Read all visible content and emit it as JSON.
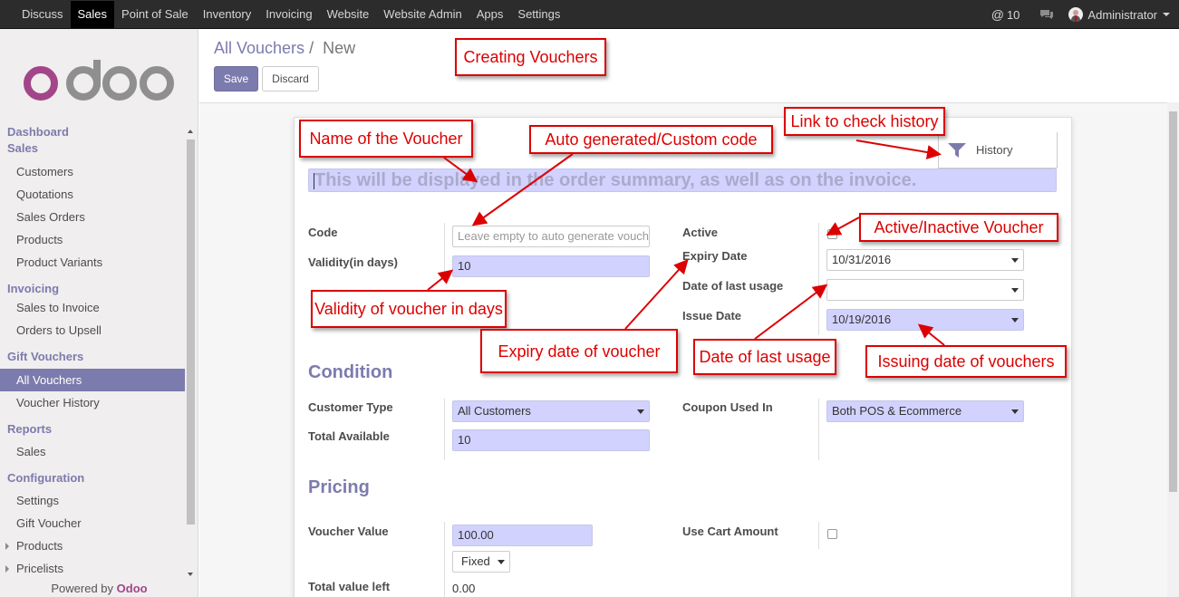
{
  "topbar": {
    "menu": [
      "Discuss",
      "Sales",
      "Point of Sale",
      "Inventory",
      "Invoicing",
      "Website",
      "Website Admin",
      "Apps",
      "Settings"
    ],
    "active_menu": "Sales",
    "messages_count": "10",
    "user": "Administrator"
  },
  "sidebar": {
    "sections": [
      {
        "header": "Dashboard",
        "items": []
      },
      {
        "header": "Sales",
        "items": [
          "Customers",
          "Quotations",
          "Sales Orders",
          "Products",
          "Product Variants"
        ]
      },
      {
        "header": "Invoicing",
        "items": [
          "Sales to Invoice",
          "Orders to Upsell"
        ]
      },
      {
        "header": "Gift Vouchers",
        "items": [
          "All Vouchers",
          "Voucher History"
        ]
      },
      {
        "header": "Reports",
        "items": [
          "Sales"
        ]
      },
      {
        "header": "Configuration",
        "items": [
          "Settings",
          "Gift Voucher",
          "Products",
          "Pricelists"
        ]
      }
    ],
    "active_item": "All Vouchers",
    "powered_prefix": "Powered by",
    "powered_brand": "Odoo"
  },
  "breadcrumb": {
    "parent": "All Vouchers",
    "sep": "/",
    "current": "New"
  },
  "buttons": {
    "save": "Save",
    "discard": "Discard",
    "history": "History"
  },
  "form": {
    "name_placeholder": "This will be displayed in the order summary, as well as on the invoice.",
    "code_label": "Code",
    "code_placeholder": "Leave empty to auto generate voucher code",
    "validity_label": "Validity(in days)",
    "validity_value": "10",
    "active_label": "Active",
    "active_checked": true,
    "expiry_label": "Expiry Date",
    "expiry_value": "10/31/2016",
    "last_usage_label": "Date of last usage",
    "last_usage_value": "",
    "issue_label": "Issue Date",
    "issue_value": "10/19/2016",
    "condition_title": "Condition",
    "customer_type_label": "Customer Type",
    "customer_type_value": "All Customers",
    "total_available_label": "Total Available",
    "total_available_value": "10",
    "coupon_used_label": "Coupon Used In",
    "coupon_used_value": "Both POS & Ecommerce",
    "pricing_title": "Pricing",
    "voucher_value_label": "Voucher Value",
    "voucher_value": "100.00",
    "voucher_type": "Fixed",
    "use_cart_label": "Use Cart Amount",
    "use_cart_checked": false,
    "total_left_label": "Total value left",
    "total_left_value": "0.00"
  },
  "annotations": {
    "creating": "Creating Vouchers",
    "name": "Name of the Voucher",
    "code": "Auto generated/Custom code",
    "history": "Link to check history",
    "active": "Active/Inactive Voucher",
    "validity": "Validity of voucher in days",
    "expiry": "Expiry date of voucher",
    "last_usage": "Date of last usage",
    "issue": "Issuing date of vouchers"
  },
  "colors": {
    "accent": "#7c7bad",
    "brand": "#a24689",
    "annotation": "#dd0000",
    "required_field": "#d2d2ff"
  },
  "icons": {
    "messages": "at-icon",
    "chat": "chat-icon",
    "history": "filter-icon"
  }
}
